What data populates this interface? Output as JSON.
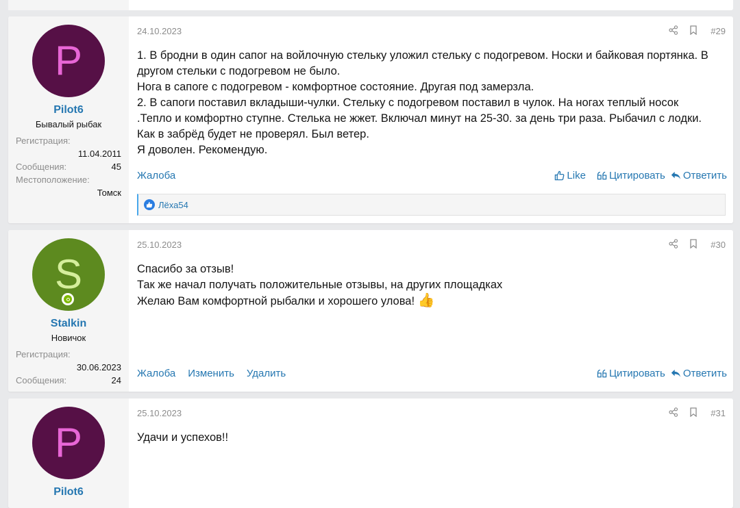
{
  "posts": [
    {
      "avatar_letter": "P",
      "avatar_bg": "#561046",
      "avatar_fg": "#e866d6",
      "username": "Pilot6",
      "user_title": "Бывалый рыбак",
      "stats": {
        "reg_label": "Регистрация:",
        "reg_value": "11.04.2011",
        "msg_label": "Сообщения:",
        "msg_value": "45",
        "loc_label": "Местоположение:",
        "loc_value": "Томск"
      },
      "date": "24.10.2023",
      "number": "#29",
      "body": [
        "1. В бродни в один сапог на войлочную стельку уложил стельку с подогревом. Носки и байковая портянка. В",
        "другом стельки с подогревом не было.",
        "Нога в сапоге с подогревом - комфортное состояние. Другая под замерзла.",
        "2. В сапоги поставил вкладыши-чулки. Стельку с подогревом поставил в чулок. На ногах теплый носок",
        ".Тепло и комфортно ступне. Стелька не жжет. Включал минут на 25-30. за день три раза. Рыбачил с лодки.",
        "Как в забрёд будет не проверял. Был ветер.",
        "Я доволен. Рекомендую."
      ],
      "actions": {
        "report": "Жалоба",
        "like": "Like",
        "quote": "Цитировать",
        "reply": "Ответить"
      },
      "reaction_user": "Лёха54"
    },
    {
      "avatar_letter": "S",
      "avatar_bg": "#5d8a1f",
      "avatar_fg": "#d5ee9c",
      "username": "Stalkin",
      "user_title": "Новичок",
      "stats": {
        "reg_label": "Регистрация:",
        "reg_value": "30.06.2023",
        "msg_label": "Сообщения:",
        "msg_value": "24"
      },
      "date": "25.10.2023",
      "number": "#30",
      "body": [
        "Спасибо за отзыв!",
        "Так же начал получать положительные отзывы, на других площадках",
        "Желаю Вам комфортной рыбалки и хорошего улова!"
      ],
      "thumb": "👍",
      "actions": {
        "report": "Жалоба",
        "edit": "Изменить",
        "delete": "Удалить",
        "quote": "Цитировать",
        "reply": "Ответить"
      }
    },
    {
      "avatar_letter": "P",
      "avatar_bg": "#561046",
      "avatar_fg": "#e866d6",
      "username": "Pilot6",
      "date": "25.10.2023",
      "number": "#31",
      "body": [
        "Удачи и успехов!!"
      ]
    }
  ],
  "icons": {
    "share": "share-icon",
    "bookmark": "bookmark-icon",
    "like": "thumbs-up-icon",
    "quote": "quote-icon",
    "reply": "reply-icon"
  },
  "colors": {
    "link": "#2577b1",
    "muted": "#8c8c8c",
    "online": "#7fb900"
  }
}
